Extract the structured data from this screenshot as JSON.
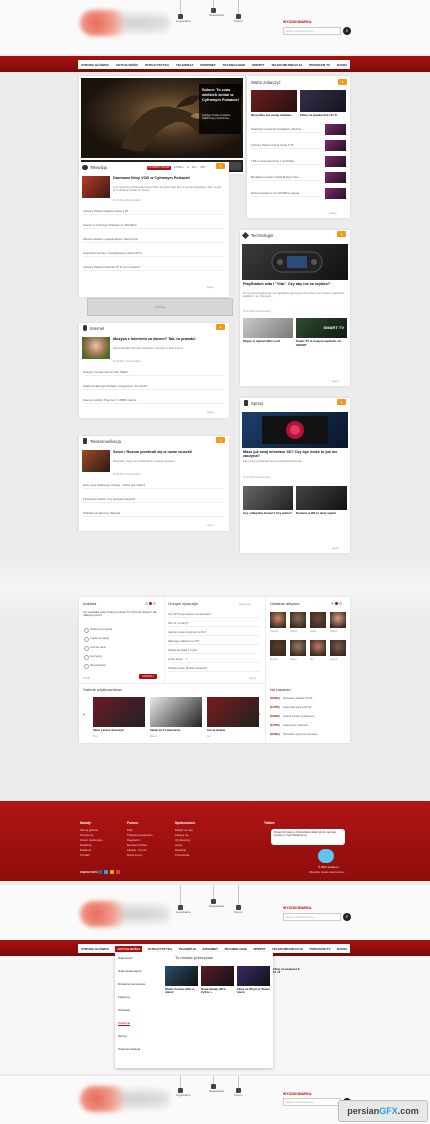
{
  "header": {
    "icons": [
      {
        "label": "Logowanie",
        "icon": "lock-icon"
      },
      {
        "label": "Rejestracja",
        "icon": "user-icon"
      },
      {
        "label": "Forum",
        "icon": "chat-icon"
      }
    ],
    "search_label": "WYSZUKIWARKA",
    "search_placeholder": "wpisz szukaną frazę..."
  },
  "nav": [
    "STRONA GŁÓWNA",
    "AKTUALNOŚCI",
    "PUBLICYSTYKA",
    "TELEWIZJA",
    "INTERNET",
    "TECHNOLOGIE",
    "SPRZĘT",
    "TELEKOMUNIKACJA",
    "PROGRAM TV",
    "RADIO"
  ],
  "hero": {
    "title": "Solorz: To czas wielkich zmian w Cyfrowym Polsacie!",
    "text": "Cyfrowy Polsat przejdzie najbliższej przebudowę..."
  },
  "worth": {
    "title": "Warto zobaczyć",
    "items": [
      {
        "title": "Wszystko ma swoje zadanie...",
        "thumb": "#5b1c1c"
      },
      {
        "title": "Filmy na weekend 9-10 / 8",
        "thumb": "#2c2a40"
      }
    ],
    "list": [
      "Telewizja 3 pokonali Instalatorzy Możesz...",
      "Cyfrowy Polsat zmienił ofertę 1 TF",
      "TNK w nowej komórce z tej Polska",
      "Bezpłatna wyzwa w Multi Muzycz Stre...",
      "Netia przypięta w nie 100 Mb/s i więcej"
    ]
  },
  "tv": {
    "title": "Telewizja",
    "tabs": [
      "CYFROWY POLSAT",
      "CYFRA +",
      "N",
      "NC +",
      "UPC"
    ],
    "lead_title": "Darmowe filmy VOD w Cyfrowym Polsacie!",
    "lead_text": "I nie, nie jest to zmiana darmowej VOD, aby ktoś może filmy w tej samej kategorii. Jak i co jest do Cyfrowego Polsat TV, klienci...",
    "lead_meta": "11.06.2011   13 komentarzy",
    "list": [
      "Cyfrowy Polsat zwiększa ofertę 1 PF",
      "Internet w Cyfrowym Polsacie do 150 Mb/s!",
      "Zderza ostatnie i najpiękniejsze! Naszyczem",
      "Czarnowa niemiec i szczególnej w ofercie IPTV...",
      "Cyfrowy Polsat wzmacnia TV 8. Co to będzie?"
    ],
    "more": "więcej"
  },
  "ad": {
    "label": "reklama"
  },
  "tech": {
    "title": "Technologie",
    "lead_title": "PlayStation wita i \"Vita\". Czy aby nie za szybko?",
    "lead_text": "To nie jedna konferencja, nie największe gamingowe firmy Sony bez prawa o usłyszeniu wiedzieć i nie. Odnośnie...",
    "lead_meta": "11.06.2011   13 komentarzy",
    "sub": [
      {
        "title": "Skype w rękach Microsoft"
      },
      {
        "title": "Smart TV w nowym wydaniu od SMART"
      }
    ],
    "sub_tv": "SMART TV",
    "more": "więcej"
  },
  "internet": {
    "title": "Internet",
    "lead_title": "Muzyka z Internetu za darmo? Tak, to prawda!",
    "lead_text": "Zapowiedziałby Muzyka uzbrajana z Internetu w kilku innych...",
    "lead_meta": "11.06.2011   13 komentarzy",
    "list": [
      "Orange i Google internet dla \"Tablet\"",
      "Telekomunikacyjna Polska z programem \"Fun Pack\"",
      "Internet mobilny. Play bez 7 i 8MB/s darmo..."
    ],
    "more": "więcej"
  },
  "sprzet": {
    "title": "Sprzęt",
    "lead_title": "Masz już swój telewizor 3D? Czy być może to już nie zaczyna?",
    "lead_text": "Nie ma co się kłopotać Sony kwestia telewizora 3D...",
    "lead_meta": "11.06.2011   13 komentarzy",
    "sub": [
      {
        "title": "Czy odkupiłeś Canon? Czy warto?"
      },
      {
        "title": "Kamera w HD to duży wybór"
      }
    ],
    "more": "więcej"
  },
  "telekom": {
    "title": "Telekomunikacja",
    "lead_title": "Serce i Rozum przebrali się w nowe ciuszki!",
    "lead_text": "Wszystko, czego nie potrzebujesz w Orange wpisane...",
    "lead_meta": "11.06.2011   13 komentarzy",
    "list": [
      "Nowy spot reklamowy Orange - Dobry jest online?",
      "TP jeszcze tańsza. Czy sieciowa zażywa?",
      "5 Mobile już aktywny. Wiosna!"
    ],
    "more": "więcej"
  },
  "poll": {
    "title": "Ankieta",
    "question": "Czy spotkałeś nowe zmiany w ofercie TV Cyfry lub Orange? Jak najlepiej ocenić?",
    "options": [
      "Ostatnio jest gorzej",
      "Lepiej nie więcej",
      "Jest tak samo",
      "Jest lepiej",
      "Nie pamiętam"
    ],
    "results_label": "Wyniki",
    "vote_label": "GŁOSUJ"
  },
  "hot": {
    "title": "Gorące dyskusje",
    "items": [
      "Czy IPTV jest lepsze od internetu?",
      "Pre mi i zmiany?",
      "Jak się macie prognozy w 4G?",
      "Dlaczego płacicie za TV?",
      "Polsat się dzieli z Cyfrą",
      "Gdzie kupić ...?",
      "Polsat prawie, Będzie świetnie?"
    ],
    "new_label": "Zapytaj się",
    "more": "więcej"
  },
  "active": {
    "title": "Ostatnio aktywni",
    "users": [
      "Justyna",
      "Robert",
      "Kasia",
      "Marcin",
      "Monika",
      "Paweł",
      "Ala",
      "Tomek"
    ]
  },
  "gallery": {
    "title": "Galerie użytkowników",
    "items": [
      {
        "title": "Salon z kinem domowym",
        "by": "Piotr"
      },
      {
        "title": "Studio do 5.1 wieczorem",
        "by": "Marcin"
      },
      {
        "title": "Gra na ekranie",
        "by": "Jan"
      }
    ]
  },
  "bazaar": {
    "title": "Na bazarze:",
    "items": [
      {
        "tag": "[NOWE]",
        "text": "Sprzedam dekoder PLUS"
      },
      {
        "tag": "[KUPIĘ]",
        "text": "Kupię Samsung LCD 32\""
      },
      {
        "tag": "[NOWE]",
        "text": "Antena zestaw wystawiona"
      },
      {
        "tag": "[KUPIĘ]",
        "text": "Kupię tanio multiroom"
      },
      {
        "tag": "[NOWE]",
        "text": "Sprzedam sprzęt na wymianę"
      }
    ]
  },
  "footer": {
    "cols": [
      {
        "h": "Kanały:",
        "items": [
          "Strona główna",
          "Porady tvp",
          "Forum dyskusyjne",
          "Redakcja",
          "Reklama",
          "Kontakt"
        ]
      },
      {
        "h": "Pomoc:",
        "items": [
          "FAQ",
          "Polityka prywatności",
          "Regulamin",
          "Bezpieczeństwo",
          "Zasady - Forum",
          "Mapa strony"
        ]
      },
      {
        "h": "Społeczność:",
        "items": [
          "Dołącz do nas",
          "Zaloguj się",
          "Użytkownicy",
          "Grupy",
          "Rankingi",
          "Przewodnik"
        ]
      }
    ],
    "twitter_h": "Twitter:",
    "tweet": "Ponad 10 tysięcy użytkowników dołączyło do naszego serwisu w maju! Dziękujemy!",
    "follow": "ZOBACZ NAS:",
    "copyright": "© 2011 serwis.pl",
    "rights": "Wszelkie prawa zastrzeżone"
  },
  "dropdown": {
    "items": [
      "Najnowsze",
      "Najpopularniejsze",
      "Działanie konsolowe",
      "Felietony",
      "Wywiady",
      "Telewizja",
      "Sprzęt",
      "Telekomunikacja"
    ],
    "feature_title": "To musisz przeczytać",
    "feature": [
      {
        "title": "Shrek: Forever after w domu!"
      },
      {
        "title": "Nowe kanały HD w Cyfrze +"
      },
      {
        "title": "Filmy na 2D już w Twoim domu"
      },
      {
        "title": "Filmy na weekend 9-10 / 8"
      }
    ]
  },
  "watermark": {
    "a": "persian",
    "b": "GFX",
    "c": ".com"
  }
}
